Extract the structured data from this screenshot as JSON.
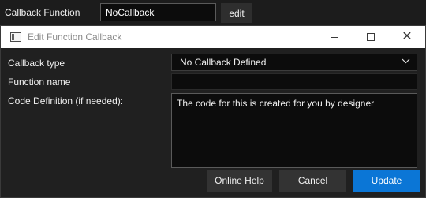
{
  "property": {
    "label": "Callback Function",
    "value": "NoCallback",
    "edit_label": "edit"
  },
  "dialog": {
    "title": "Edit Function Callback",
    "callback_type_label": "Callback type",
    "callback_type_value": "No Callback Defined",
    "function_name_label": "Function name",
    "function_name_value": "",
    "code_label": "Code Definition (if needed):",
    "code_value": "The code for this is created for you by designer",
    "buttons": {
      "help": "Online Help",
      "cancel": "Cancel",
      "update": "Update"
    }
  },
  "icons": [
    "app-window-icon",
    "minimize-icon",
    "maximize-icon",
    "close-icon",
    "chevron-down-icon"
  ],
  "colors": {
    "accent": "#0b76d6",
    "background": "#202020",
    "field": "#0c0c0c"
  }
}
